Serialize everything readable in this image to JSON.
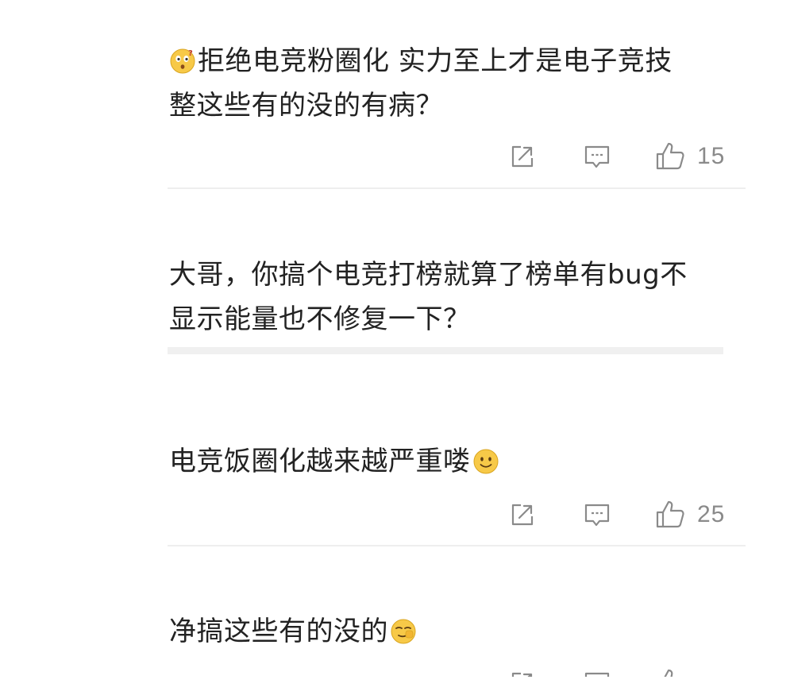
{
  "comments": [
    {
      "lead_emoji": "thinking-face-emoji",
      "text": "拒绝电竞粉圈化 实力至上才是电子竞技\n整这些有的没的有病？",
      "likes": "15"
    },
    {
      "text": "大哥，你搞个电竞打榜就算了榜单有bug不\n显示能量也不修复一下？"
    },
    {
      "text": "电竞饭圈化越来越严重喽",
      "trail_emoji": "smile-face-emoji",
      "likes": "25"
    },
    {
      "text": "净搞这些有的没的",
      "trail_emoji": "sly-face-emoji"
    }
  ],
  "icons": {
    "share": "share-icon",
    "comment": "comment-icon",
    "like": "thumbs-up-icon"
  },
  "colors": {
    "text": "#222222",
    "icon": "#8a8a8a",
    "divider": "#eeeeee",
    "emoji_yellow": "#f7c948"
  }
}
